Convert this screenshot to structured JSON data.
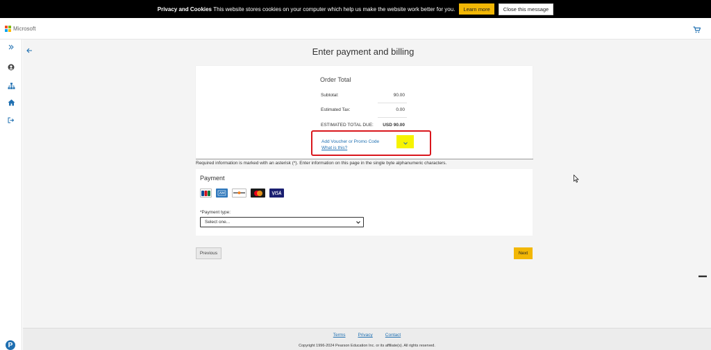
{
  "cookie_bar": {
    "title": "Privacy and Cookies",
    "message": "This website stores cookies on your computer which help us make the website work better for you.",
    "learn_more_label": "Learn more",
    "close_label": "Close this message"
  },
  "header": {
    "brand": "Microsoft",
    "logo_colors": [
      "#f25022",
      "#7fba00",
      "#00a4ef",
      "#ffb900"
    ]
  },
  "rail": {
    "icons": [
      "expand-icon",
      "user-icon",
      "sitemap-icon",
      "home-icon",
      "sign-out-icon"
    ],
    "brand_letter": "P"
  },
  "page": {
    "title": "Enter payment and billing"
  },
  "order": {
    "title": "Order Total",
    "subtotal_label": "Subtotal:",
    "subtotal_value": "90.00",
    "tax_label": "Estimated Tax:",
    "tax_value": "0.00",
    "total_label": "ESTIMATED TOTAL DUE:",
    "total_value": "USD 90.00",
    "voucher_label": "Add Voucher or Promo Code",
    "what_is_this": "What is this?"
  },
  "required_note": "Required information is marked with an asterisk (*). Enter information on this page in the single byte alphanumeric characters.",
  "payment": {
    "title": "Payment",
    "cards": [
      "JCB",
      "AMEX",
      "DISCOVER",
      "MC",
      "VISA"
    ],
    "type_label": "*Payment type:",
    "type_selected": "Select one..."
  },
  "actions": {
    "previous_label": "Previous",
    "next_label": "Next"
  },
  "footer": {
    "terms": "Terms",
    "privacy": "Privacy",
    "contact": "Contact",
    "copyright": "Copyright 1996-2024 Pearson Education Inc. or its affiliate(s). All rights reserved."
  },
  "colors": {
    "accent": "#f2b705",
    "link": "#1e6fb1",
    "highlight_border": "#d9161c",
    "highlight_fill": "#f6f300"
  }
}
